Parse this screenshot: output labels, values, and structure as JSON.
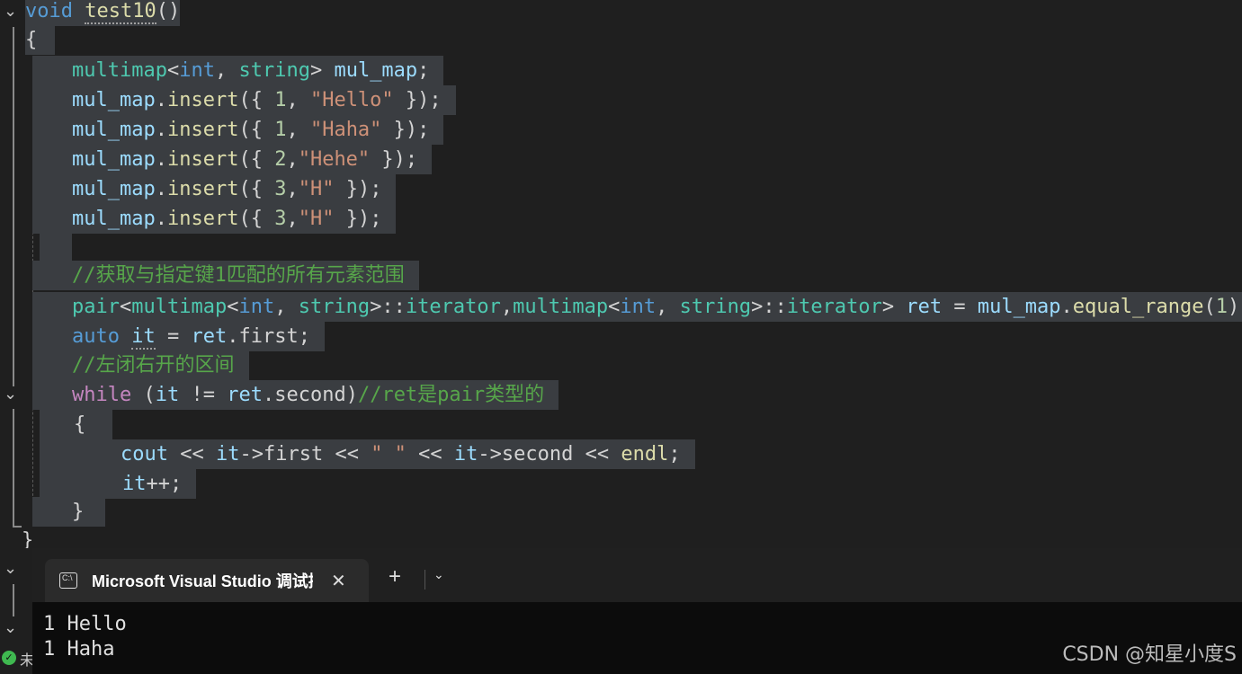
{
  "editor": {
    "lines": {
      "l0": [
        "void",
        " ",
        "test10",
        "()"
      ],
      "l1": [
        "{"
      ],
      "l2": [
        "multimap",
        "<",
        "int",
        ", ",
        "string",
        "> ",
        "mul_map",
        ";"
      ],
      "l3": [
        "mul_map",
        ".",
        "insert",
        "({ ",
        "1",
        ", ",
        "\"Hello\"",
        " });"
      ],
      "l4": [
        "mul_map",
        ".",
        "insert",
        "({ ",
        "1",
        ", ",
        "\"Haha\"",
        " });"
      ],
      "l5": [
        "mul_map",
        ".",
        "insert",
        "({ ",
        "2",
        ",",
        "\"Hehe\"",
        " });"
      ],
      "l6": [
        "mul_map",
        ".",
        "insert",
        "({ ",
        "3",
        ",",
        "\"H\"",
        " });"
      ],
      "l7": [
        "mul_map",
        ".",
        "insert",
        "({ ",
        "3",
        ",",
        "\"H\"",
        " });"
      ],
      "l9": [
        "//获取与指定键1匹配的所有元素范围"
      ],
      "l10": [
        "pair",
        "<",
        "multimap",
        "<",
        "int",
        ", ",
        "string",
        ">::",
        "iterator",
        ",",
        "multimap",
        "<",
        "int",
        ", ",
        "string",
        ">::",
        "iterator",
        "> ",
        "ret",
        " = ",
        "mul_map",
        ".",
        "equal_range",
        "(",
        "1",
        ")"
      ],
      "l11": [
        "auto",
        " ",
        "it",
        " = ",
        "ret",
        ".",
        "first",
        ";"
      ],
      "l12": [
        "//左闭右开的区间"
      ],
      "l13": [
        "while",
        " (",
        "it",
        " != ",
        "ret",
        ".",
        "second",
        ")",
        "//ret是pair类型的"
      ],
      "l14": [
        "{"
      ],
      "l15": [
        "cout",
        " << ",
        "it",
        "->",
        "first",
        " << ",
        "\" \"",
        " << ",
        "it",
        "->",
        "second",
        " << ",
        "endl",
        ";"
      ],
      "l16": [
        "it",
        "++;"
      ],
      "l17": [
        "}"
      ],
      "l18": [
        "}"
      ]
    },
    "colors": {
      "keyword": "#569cd6",
      "type": "#4ec9b0",
      "variable": "#9cdcfe",
      "function": "#dcdcaa",
      "string": "#ce9178",
      "number": "#b5cea8",
      "comment": "#57a64a",
      "control": "#c586c0",
      "selection": "#3a3d41"
    }
  },
  "terminal": {
    "tab_title": "Microsoft Visual Studio 调试控制台",
    "tab_icon_text": "C:\\",
    "close_glyph": "✕",
    "new_tab_glyph": "+",
    "dropdown_glyph": "⌄",
    "output": [
      "1 Hello",
      "1 Haha"
    ]
  },
  "status": {
    "text": "未"
  },
  "watermark": "CSDN @知星小度S"
}
